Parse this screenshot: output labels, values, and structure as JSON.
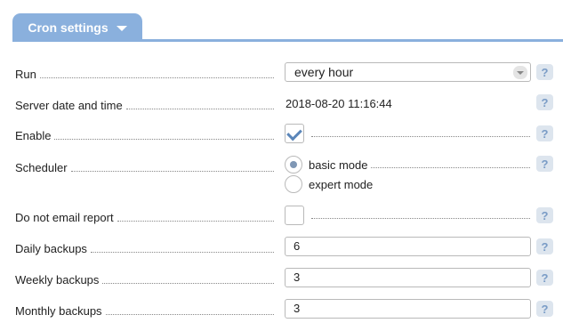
{
  "tab": {
    "label": "Cron settings"
  },
  "fields": {
    "run": {
      "label": "Run",
      "value": "every hour"
    },
    "server_time": {
      "label": "Server date and time",
      "value": "2018-08-20 11:16:44"
    },
    "enable": {
      "label": "Enable",
      "checked": true
    },
    "scheduler": {
      "label": "Scheduler",
      "options": [
        "basic mode",
        "expert mode"
      ],
      "selected": "basic mode"
    },
    "no_email": {
      "label": "Do not email report",
      "checked": false
    },
    "daily": {
      "label": "Daily backups",
      "value": "6"
    },
    "weekly": {
      "label": "Weekly backups",
      "value": "3"
    },
    "monthly": {
      "label": "Monthly backups",
      "value": "3"
    }
  },
  "help": {
    "glyph": "?"
  },
  "colors": {
    "accent": "#8ab0dd",
    "check": "#5b86b9",
    "help_bg": "#dde5ee",
    "help_fg": "#7a9cc6"
  }
}
